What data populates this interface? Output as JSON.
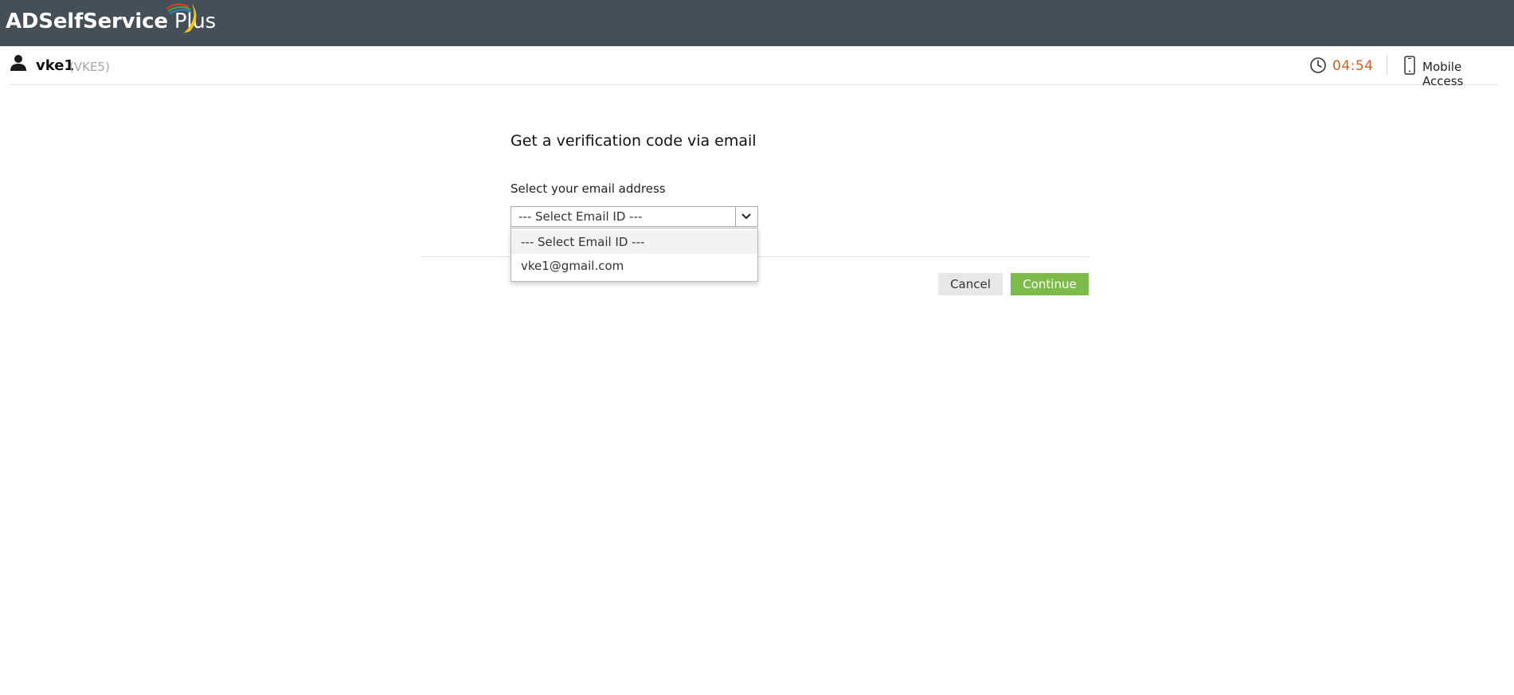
{
  "header": {
    "brand_bold": "ADSelfService",
    "brand_light": " Plus",
    "bar_color": "#444f57"
  },
  "userbar": {
    "username": "vke1",
    "user_domain": "(VKE5)",
    "timer": "04:54",
    "timer_color": "#c8602a",
    "mobile_access_label": "Mobile Access",
    "icons": [
      "user-icon",
      "clock-icon",
      "mobile-phone-icon"
    ]
  },
  "main": {
    "title": "Get a verification code via email",
    "field_label": "Select your email address",
    "select": {
      "selected": "--- Select Email ID ---",
      "options": [
        "--- Select Email ID ---",
        "vke1@gmail.com"
      ],
      "highlighted_index": 0
    },
    "buttons": {
      "cancel": "Cancel",
      "continue": "Continue",
      "continue_color": "#7cba49"
    }
  }
}
